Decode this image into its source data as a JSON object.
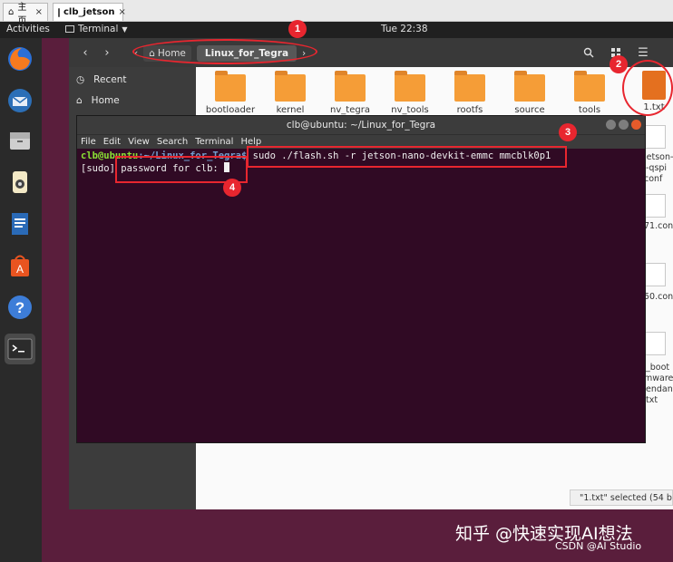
{
  "vm_tabs": {
    "home_label": "主页",
    "machine_label": "clb_jetson",
    "close_glyph": "×"
  },
  "top_bar": {
    "activities": "Activities",
    "app_menu": "Terminal",
    "clock": "Tue 22:38"
  },
  "files": {
    "path_home": "Home",
    "path_current": "Linux_for_Tegra",
    "sidebar": [
      {
        "label": "Recent",
        "icon": "clock-icon"
      },
      {
        "label": "Home",
        "icon": "home-icon"
      }
    ],
    "folders": [
      "bootloader",
      "kernel",
      "nv_tegra",
      "nv_tools",
      "rootfs",
      "source",
      "tools"
    ],
    "selected_file": "1.txt",
    "partial_labels": [
      "jetson-",
      "o-qspi",
      "conf",
      "71.con",
      "50.con",
      "_boot",
      "mware-",
      "pendanc",
      "txt"
    ],
    "status": "\"1.txt\" selected (54 b"
  },
  "terminal": {
    "title": "clb@ubuntu: ~/Linux_for_Tegra",
    "menu": [
      "File",
      "Edit",
      "View",
      "Search",
      "Terminal",
      "Help"
    ],
    "prompt_user": "clb@ubuntu",
    "prompt_path": ":~/Linux_for_Tegra$",
    "command": " sudo ./flash.sh -r jetson-nano-devkit-emmc mmcblk0p1",
    "sudo_prompt": "[sudo] password for clb: "
  },
  "annotations": [
    "1",
    "2",
    "3",
    "4"
  ],
  "watermark": "知乎 @快速实现AI想法",
  "csdn": "CSDN @AI Studio",
  "colors": {
    "terminal_bg": "#300a24",
    "annotation": "#e8262f",
    "folder": "#f59d37"
  }
}
